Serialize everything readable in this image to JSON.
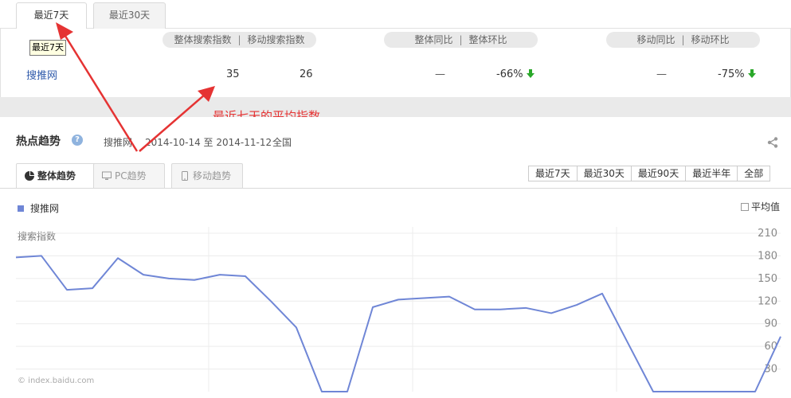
{
  "period_tabs": [
    {
      "label": "最近7天",
      "active": true
    },
    {
      "label": "最近30天",
      "active": false
    }
  ],
  "tooltip": "最近7天",
  "summary": {
    "headers": {
      "group1": [
        "整体搜索指数",
        "移动搜索指数"
      ],
      "group2": [
        "整体同比",
        "整体环比"
      ],
      "group3": [
        "移动同比",
        "移动环比"
      ],
      "separator": "|"
    },
    "row": {
      "keyword": "搜推网",
      "overall_index": "35",
      "mobile_index": "26",
      "overall_yoy": "—",
      "overall_mom": "-66%",
      "mobile_yoy": "—",
      "mobile_mom": "-75%"
    },
    "trend_down_color": "#2aa82a"
  },
  "annotation": {
    "text": "最近七天的平均指数",
    "color": "#e53333"
  },
  "trend": {
    "title": "热点趋势",
    "help": "?",
    "keyword": "搜推网",
    "date_range": "2014-10-14 至 2014-11-12",
    "region": "全国",
    "view_tabs": [
      {
        "label": "整体趋势",
        "icon": "pie-chart-icon",
        "active": true
      },
      {
        "label": "PC趋势",
        "icon": "monitor-icon",
        "active": false
      },
      {
        "label": "移动趋势",
        "icon": "mobile-phone-icon",
        "active": false
      }
    ],
    "range_buttons": [
      "最近7天",
      "最近30天",
      "最近90天",
      "最近半年",
      "全部"
    ],
    "legend": "搜推网",
    "average_toggle": "平均值",
    "y_axis_label": "搜索指数",
    "watermark": "© index.baidu.com"
  },
  "chart_data": {
    "type": "line",
    "ylabel": "搜索指数",
    "ylim": [
      0,
      210
    ],
    "yticks": [
      30,
      60,
      90,
      120,
      150,
      180,
      210
    ],
    "series": [
      {
        "name": "搜推网",
        "color": "#6f86d6",
        "values": [
          178,
          180,
          135,
          137,
          177,
          155,
          150,
          148,
          155,
          153,
          120,
          85,
          0,
          0,
          112,
          122,
          124,
          126,
          109,
          109,
          111,
          104,
          115,
          130,
          65,
          0,
          0,
          0,
          0,
          0,
          73
        ]
      }
    ],
    "grid": true
  }
}
